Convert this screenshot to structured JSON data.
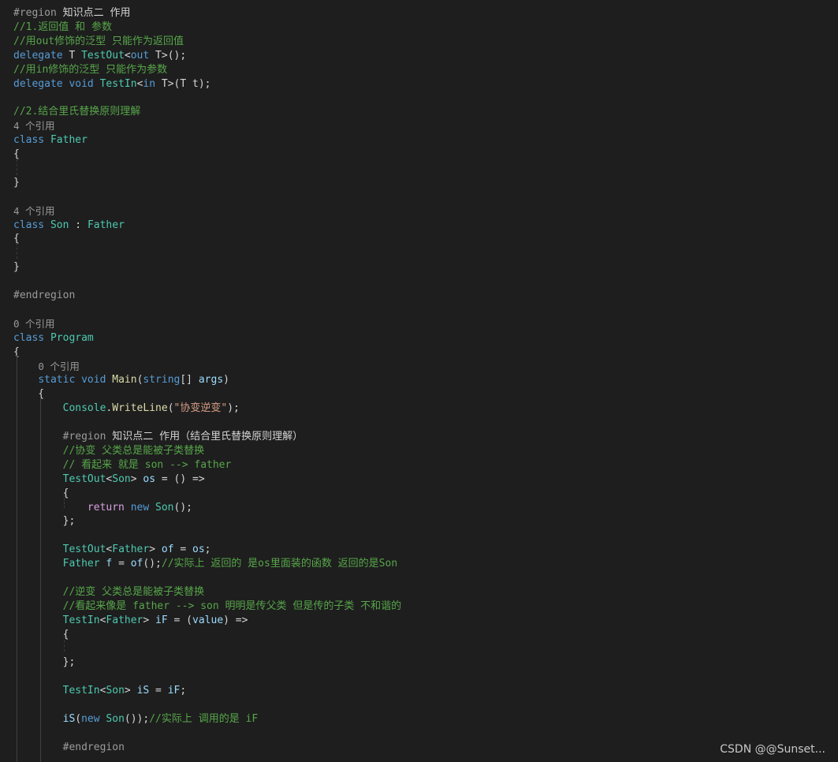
{
  "colors": {
    "background": "#1e1e1e",
    "plain": "#d4d4d4",
    "keyword": "#569cd6",
    "control": "#d8a0df",
    "type": "#4ec9b0",
    "method": "#dcdcaa",
    "variable": "#9cdcfe",
    "string": "#d69d85",
    "comment": "#57a64a",
    "preprocessor": "#9b9b9b",
    "region_label": "#d4d4d4",
    "codelens": "#999999"
  },
  "lines": [
    [
      {
        "t": "#region ",
        "c": "preprocessor"
      },
      {
        "t": "知识点二 作用",
        "c": "region_label"
      }
    ],
    [
      {
        "t": "//1.返回值 和 参数",
        "c": "comment"
      }
    ],
    [
      {
        "t": "//用out修饰的泛型 只能作为返回值",
        "c": "comment"
      }
    ],
    [
      {
        "t": "delegate",
        "c": "keyword"
      },
      {
        "t": " T ",
        "c": "plain"
      },
      {
        "t": "TestOut",
        "c": "type"
      },
      {
        "t": "<",
        "c": "plain"
      },
      {
        "t": "out",
        "c": "keyword"
      },
      {
        "t": " T>();",
        "c": "plain"
      }
    ],
    [
      {
        "t": "//用in修饰的泛型 只能作为参数",
        "c": "comment"
      }
    ],
    [
      {
        "t": "delegate",
        "c": "keyword"
      },
      {
        "t": " ",
        "c": "plain"
      },
      {
        "t": "void",
        "c": "keyword"
      },
      {
        "t": " ",
        "c": "plain"
      },
      {
        "t": "TestIn",
        "c": "type"
      },
      {
        "t": "<",
        "c": "plain"
      },
      {
        "t": "in",
        "c": "keyword"
      },
      {
        "t": " T>(T t);",
        "c": "plain"
      }
    ],
    [],
    [
      {
        "t": "//2.结合里氏替换原则理解",
        "c": "comment"
      }
    ],
    [
      {
        "t": "4 个引用",
        "c": "codelens"
      }
    ],
    [
      {
        "t": "class",
        "c": "keyword"
      },
      {
        "t": " ",
        "c": "plain"
      },
      {
        "t": "Father",
        "c": "type"
      }
    ],
    [
      {
        "t": "{",
        "c": "plain"
      }
    ],
    [],
    [
      {
        "t": "}",
        "c": "plain"
      }
    ],
    [],
    [
      {
        "t": "4 个引用",
        "c": "codelens"
      }
    ],
    [
      {
        "t": "class",
        "c": "keyword"
      },
      {
        "t": " ",
        "c": "plain"
      },
      {
        "t": "Son",
        "c": "type"
      },
      {
        "t": " : ",
        "c": "plain"
      },
      {
        "t": "Father",
        "c": "type"
      }
    ],
    [
      {
        "t": "{",
        "c": "plain"
      }
    ],
    [],
    [
      {
        "t": "}",
        "c": "plain"
      }
    ],
    [],
    [
      {
        "t": "#endregion",
        "c": "preprocessor"
      }
    ],
    [],
    [
      {
        "t": "0 个引用",
        "c": "codelens"
      }
    ],
    [
      {
        "t": "class",
        "c": "keyword"
      },
      {
        "t": " ",
        "c": "plain"
      },
      {
        "t": "Program",
        "c": "type"
      }
    ],
    [
      {
        "t": "{",
        "c": "plain"
      }
    ],
    [
      {
        "t": "    "
      },
      {
        "t": "0 个引用",
        "c": "codelens"
      }
    ],
    [
      {
        "t": "    "
      },
      {
        "t": "static",
        "c": "keyword"
      },
      {
        "t": " ",
        "c": "plain"
      },
      {
        "t": "void",
        "c": "keyword"
      },
      {
        "t": " ",
        "c": "plain"
      },
      {
        "t": "Main",
        "c": "method"
      },
      {
        "t": "(",
        "c": "plain"
      },
      {
        "t": "string",
        "c": "keyword"
      },
      {
        "t": "[] ",
        "c": "plain"
      },
      {
        "t": "args",
        "c": "variable"
      },
      {
        "t": ")",
        "c": "plain"
      }
    ],
    [
      {
        "t": "    {",
        "c": "plain"
      }
    ],
    [
      {
        "t": "        "
      },
      {
        "t": "Console",
        "c": "type"
      },
      {
        "t": ".",
        "c": "plain"
      },
      {
        "t": "WriteLine",
        "c": "method"
      },
      {
        "t": "(",
        "c": "plain"
      },
      {
        "t": "\"协变逆变\"",
        "c": "string"
      },
      {
        "t": ");",
        "c": "plain"
      }
    ],
    [],
    [
      {
        "t": "        "
      },
      {
        "t": "#region ",
        "c": "preprocessor"
      },
      {
        "t": "知识点二 作用（结合里氏替换原则理解）",
        "c": "region_label"
      }
    ],
    [
      {
        "t": "        "
      },
      {
        "t": "//协变 父类总是能被子类替换",
        "c": "comment"
      }
    ],
    [
      {
        "t": "        "
      },
      {
        "t": "// 看起来 就是 son --> father",
        "c": "comment"
      }
    ],
    [
      {
        "t": "        "
      },
      {
        "t": "TestOut",
        "c": "type"
      },
      {
        "t": "<",
        "c": "plain"
      },
      {
        "t": "Son",
        "c": "type"
      },
      {
        "t": "> ",
        "c": "plain"
      },
      {
        "t": "os",
        "c": "variable"
      },
      {
        "t": " = () =>",
        "c": "plain"
      }
    ],
    [
      {
        "t": "        {",
        "c": "plain"
      }
    ],
    [
      {
        "t": "            "
      },
      {
        "t": "return",
        "c": "control"
      },
      {
        "t": " ",
        "c": "plain"
      },
      {
        "t": "new",
        "c": "keyword"
      },
      {
        "t": " ",
        "c": "plain"
      },
      {
        "t": "Son",
        "c": "type"
      },
      {
        "t": "();",
        "c": "plain"
      }
    ],
    [
      {
        "t": "        };",
        "c": "plain"
      }
    ],
    [],
    [
      {
        "t": "        "
      },
      {
        "t": "TestOut",
        "c": "type"
      },
      {
        "t": "<",
        "c": "plain"
      },
      {
        "t": "Father",
        "c": "type"
      },
      {
        "t": "> ",
        "c": "plain"
      },
      {
        "t": "of",
        "c": "variable"
      },
      {
        "t": " = ",
        "c": "plain"
      },
      {
        "t": "os",
        "c": "variable"
      },
      {
        "t": ";",
        "c": "plain"
      }
    ],
    [
      {
        "t": "        "
      },
      {
        "t": "Father",
        "c": "type"
      },
      {
        "t": " ",
        "c": "plain"
      },
      {
        "t": "f",
        "c": "variable"
      },
      {
        "t": " = ",
        "c": "plain"
      },
      {
        "t": "of",
        "c": "variable"
      },
      {
        "t": "();",
        "c": "plain"
      },
      {
        "t": "//实际上 返回的 是os里面装的函数 返回的是Son",
        "c": "comment"
      }
    ],
    [],
    [
      {
        "t": "        "
      },
      {
        "t": "//逆变 父类总是能被子类替换",
        "c": "comment"
      }
    ],
    [
      {
        "t": "        "
      },
      {
        "t": "//看起来像是 father --> son 明明是传父类 但是传的子类 不和谐的",
        "c": "comment"
      }
    ],
    [
      {
        "t": "        "
      },
      {
        "t": "TestIn",
        "c": "type"
      },
      {
        "t": "<",
        "c": "plain"
      },
      {
        "t": "Father",
        "c": "type"
      },
      {
        "t": "> ",
        "c": "plain"
      },
      {
        "t": "iF",
        "c": "variable"
      },
      {
        "t": " = (",
        "c": "plain"
      },
      {
        "t": "value",
        "c": "variable"
      },
      {
        "t": ") =>",
        "c": "plain"
      }
    ],
    [
      {
        "t": "        {",
        "c": "plain"
      }
    ],
    [],
    [
      {
        "t": "        };",
        "c": "plain"
      }
    ],
    [],
    [
      {
        "t": "        "
      },
      {
        "t": "TestIn",
        "c": "type"
      },
      {
        "t": "<",
        "c": "plain"
      },
      {
        "t": "Son",
        "c": "type"
      },
      {
        "t": "> ",
        "c": "plain"
      },
      {
        "t": "iS",
        "c": "variable"
      },
      {
        "t": " = ",
        "c": "plain"
      },
      {
        "t": "iF",
        "c": "variable"
      },
      {
        "t": ";",
        "c": "plain"
      }
    ],
    [],
    [
      {
        "t": "        "
      },
      {
        "t": "iS",
        "c": "variable"
      },
      {
        "t": "(",
        "c": "plain"
      },
      {
        "t": "new",
        "c": "keyword"
      },
      {
        "t": " ",
        "c": "plain"
      },
      {
        "t": "Son",
        "c": "type"
      },
      {
        "t": "());",
        "c": "plain"
      },
      {
        "t": "//实际上 调用的是 iF",
        "c": "comment"
      }
    ],
    [],
    [
      {
        "t": "        "
      },
      {
        "t": "#endregion",
        "c": "preprocessor"
      }
    ],
    [],
    []
  ],
  "watermark": "CSDN @@Sunset..."
}
